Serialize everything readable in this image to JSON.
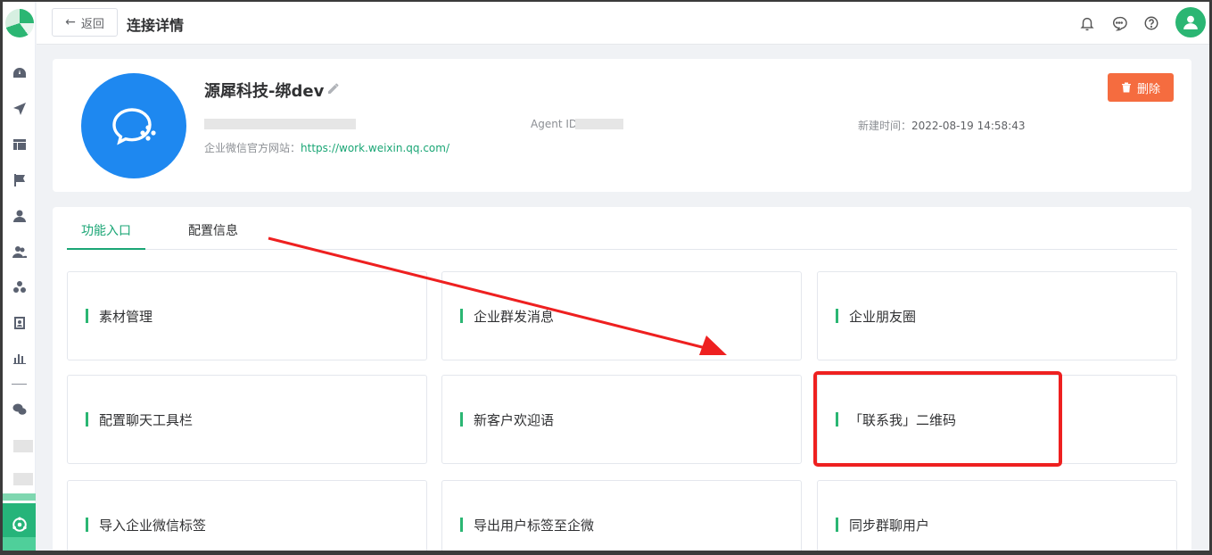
{
  "header": {
    "back_label": "返回",
    "title": "连接详情"
  },
  "corp": {
    "name": "源犀科技-绑dev",
    "agent_label": "Agent ID",
    "created_label": "新建时间：",
    "created_value": "2022-08-19 14:58:43",
    "site_label": "企业微信官方网站：",
    "site_url": "https://work.weixin.qq.com/",
    "delete_label": "删除"
  },
  "tabs": [
    {
      "label": "功能入口",
      "active": true
    },
    {
      "label": "配置信息",
      "active": false
    }
  ],
  "features": [
    {
      "label": "素材管理"
    },
    {
      "label": "企业群发消息"
    },
    {
      "label": "企业朋友圈"
    },
    {
      "label": "配置聊天工具栏"
    },
    {
      "label": "新客户欢迎语"
    },
    {
      "label": "「联系我」二维码"
    },
    {
      "label": "导入企业微信标签"
    },
    {
      "label": "导出用户标签至企微"
    },
    {
      "label": "同步群聊用户"
    }
  ],
  "colors": {
    "brand": "#2bb673",
    "link": "#1aa675",
    "danger": "#f56c3f",
    "wechat_work_blue": "#1e88f0",
    "annotation_red": "#ee2020"
  },
  "icons": {
    "sidebar": [
      "dashboard-icon",
      "send-icon",
      "layout-icon",
      "flag-icon",
      "user-icon",
      "users-icon",
      "cluster-icon",
      "contact-card-icon",
      "bar-chart-icon",
      "wechat-icon",
      "wecom-icon"
    ],
    "header": [
      "bell-icon",
      "chat-icon",
      "help-icon",
      "avatar-icon"
    ]
  }
}
